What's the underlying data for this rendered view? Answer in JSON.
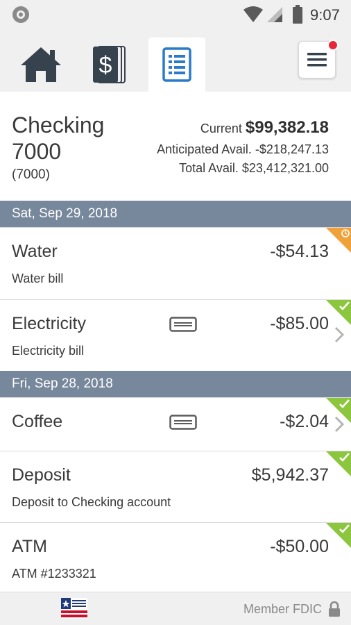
{
  "status_bar": {
    "time": "9:07"
  },
  "tabs": [
    {
      "name": "home",
      "icon": "home-icon"
    },
    {
      "name": "accounts",
      "icon": "dollar-cards-icon"
    },
    {
      "name": "transactions",
      "icon": "document-list-icon",
      "active": true
    }
  ],
  "menu": {
    "icon": "hamburger-menu-icon",
    "has_notification": true
  },
  "account": {
    "name": "Checking 7000",
    "number": "(7000)",
    "current_label": "Current",
    "current_amount": "$99,382.18",
    "anticipated": "Anticipated Avail. -$218,247.13",
    "total": "Total Avail. $23,412,321.00"
  },
  "date_groups": [
    {
      "date": "Sat, Sep 29, 2018"
    },
    {
      "date": "Fri, Sep 28, 2018"
    }
  ],
  "transactions": [
    {
      "title": "Water",
      "description": "Water bill",
      "amount": "-$54.13",
      "status": "pending"
    },
    {
      "title": "Electricity",
      "description": "Electricity bill",
      "amount": "-$85.00",
      "status": "cleared",
      "card": true,
      "chevron": true
    },
    {
      "title": "Coffee",
      "amount": "-$2.04",
      "status": "cleared",
      "card": true,
      "chevron": true
    },
    {
      "title": "Deposit",
      "description": "Deposit to Checking account",
      "amount": "$5,942.37",
      "status": "cleared"
    },
    {
      "title": "ATM",
      "description": "ATM #1233321",
      "amount": "-$50.00",
      "status": "cleared"
    }
  ],
  "footer": {
    "member_text": "Member FDIC"
  },
  "colors": {
    "date_header": "#77879c",
    "accent_blue": "#2a7bc8",
    "cleared": "#8cc63f",
    "pending": "#f0a23a",
    "notification": "#e8283a"
  }
}
